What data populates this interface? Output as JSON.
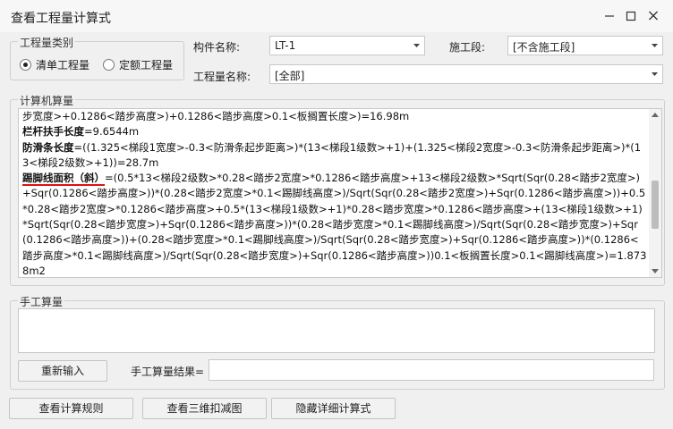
{
  "window": {
    "title": "查看工程量计算式"
  },
  "controls": {
    "minimize": "minimize",
    "maximize": "maximize",
    "close": "close"
  },
  "quantity_type": {
    "legend": "工程量类别",
    "options": [
      {
        "label": "清单工程量",
        "selected": true
      },
      {
        "label": "定额工程量",
        "selected": false
      }
    ]
  },
  "fields": {
    "component_name_label": "构件名称:",
    "component_name_value": "LT-1",
    "section_label": "施工段:",
    "section_value": "[不含施工段]",
    "quantity_name_label": "工程量名称:",
    "quantity_name_value": "[全部]"
  },
  "computer_calc": {
    "legend": "计算机算量",
    "line1": "步宽度>+0.1286<踏步高度>)+0.1286<踏步高度>0.1<板搁置长度>)=16.98m",
    "r2_name": "栏杆扶手长度",
    "r2_value": "=9.6544m",
    "r3_name": "防滑条长度",
    "r3_value": "=((1.325<梯段1宽度>-0.3<防滑条起步距离>)*(13<梯段1级数>+1)+(1.325<梯段2宽度>-0.3<防滑条起步距离>)*(13<梯段2级数>+1))=28.7m",
    "r4_name": "踢脚线面积（斜）",
    "r4_value": "=(0.5*13<梯段2级数>*0.28<踏步2宽度>*0.1286<踏步高度>+13<梯段2级数>*Sqrt(Sqr(0.28<踏步2宽度>)+Sqr(0.1286<踏步高度>))*(0.28<踏步2宽度>*0.1<踢脚线高度>)/Sqrt(Sqr(0.28<踏步2宽度>)+Sqr(0.1286<踏步高度>))+0.5*0.28<踏步2宽度>*0.1286<踏步高度>+0.5*(13<梯段1级数>+1)*0.28<踏步宽度>*0.1286<踏步高度>+(13<梯段1级数>+1)*Sqrt(Sqr(0.28<踏步宽度>)+Sqr(0.1286<踏步高度>))*(0.28<踏步宽度>*0.1<踢脚线高度>)/Sqrt(Sqr(0.28<踏步宽度>)+Sqr(0.1286<踏步高度>))+(0.28<踏步宽度>*0.1<踢脚线高度>)/Sqrt(Sqr(0.28<踏步宽度>)+Sqr(0.1286<踏步高度>))*(0.1286<踏步高度>*0.1<踢脚线高度>)/Sqrt(Sqr(0.28<踏步宽度>)+Sqr(0.1286<踏步高度>))0.1<板搁置长度>0.1<踢脚线高度>)=1.8738m2"
  },
  "manual_calc": {
    "legend": "手工算量",
    "reenter_label": "重新输入",
    "result_label": "手工算量结果="
  },
  "bottom_buttons": {
    "view_rules": "查看计算规则",
    "view_3d": "查看三维扣减图",
    "hide_detail": "隐藏详细计算式"
  }
}
